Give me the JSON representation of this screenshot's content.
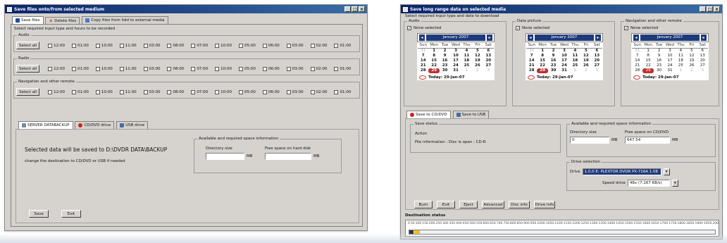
{
  "left": {
    "title": "Save files onto/from selected medium",
    "tabs": [
      {
        "label": "Save files",
        "icon": "save-disk-icon"
      },
      {
        "label": "Delete files",
        "icon": "red-x-icon"
      },
      {
        "label": "Copy files from hdd to external media",
        "icon": "copy-icon"
      }
    ],
    "instruction": "Select required input type and hours to be recorded",
    "groups": [
      {
        "label": "Audio",
        "select_all": "Select all",
        "times": [
          "12:00",
          "01:00",
          "10:00",
          "11:00",
          "03:00",
          "08:00",
          "07:00",
          "10:00",
          "05:00",
          "06:00",
          "03:00",
          "02:00",
          "01:00"
        ]
      },
      {
        "label": "Radio",
        "select_all": "Select all",
        "times": [
          "12:00",
          "01:00",
          "10:00",
          "11:00",
          "03:00",
          "08:00",
          "07:00",
          "10:00",
          "05:00",
          "06:00",
          "03:00",
          "02:00",
          "01:00"
        ]
      },
      {
        "label": "Navigation and other remote",
        "select_all": "Select all",
        "times": [
          "12:00",
          "01:00",
          "10:00",
          "11:00",
          "03:00",
          "08:00",
          "07:00",
          "10:00",
          "05:00",
          "06:00",
          "03:00",
          "02:00",
          "01:00"
        ]
      }
    ],
    "dest_tabs": [
      "SERVER DATABACKUP",
      "CD/DVD drive",
      "USB drive"
    ],
    "dest_text": "Selected data will be saved to D:\\DVDR DATA\\BACKUP",
    "dest_sub": "change the destination to CD/DVD or USB if needed",
    "space": {
      "legend": "Available and required space information",
      "dir_size_label": "Directory size",
      "free_space_label": "Free space on hard disk",
      "unit": "MB"
    },
    "buttons": {
      "save": "Save",
      "exit": "Exit"
    }
  },
  "right": {
    "title": "Save long range data on selected media",
    "instruction": "Select required input type and date to download",
    "calendars": [
      {
        "group": "Audio",
        "check_label": "None selected",
        "month": "January 2007",
        "days_head": [
          "Sun",
          "Mon",
          "Tue",
          "Wed",
          "Thu",
          "Fri",
          "Sat"
        ],
        "weeks": [
          [
            "31",
            "1",
            "2",
            "3",
            "4",
            "5",
            "6"
          ],
          [
            "7",
            "8",
            "9",
            "10",
            "11",
            "12",
            "13"
          ],
          [
            "14",
            "15",
            "16",
            "17",
            "18",
            "19",
            "20"
          ],
          [
            "21",
            "22",
            "23",
            "24",
            "25",
            "26",
            "27"
          ],
          [
            "28",
            "29",
            "30",
            "31",
            "1",
            "2",
            "3"
          ]
        ],
        "today": "Today: 29-Jan-07"
      },
      {
        "group": "Data picture",
        "check_label": "None selected",
        "month": "January 2007",
        "days_head": [
          "Sun",
          "Mon",
          "Tue",
          "Wed",
          "Thu",
          "Fri",
          "Sat"
        ],
        "weeks": [
          [
            "31",
            "1",
            "2",
            "3",
            "4",
            "5",
            "6"
          ],
          [
            "7",
            "8",
            "9",
            "10",
            "11",
            "12",
            "13"
          ],
          [
            "14",
            "15",
            "16",
            "17",
            "18",
            "19",
            "20"
          ],
          [
            "21",
            "22",
            "23",
            "24",
            "25",
            "26",
            "27"
          ],
          [
            "28",
            "29",
            "30",
            "31",
            "1",
            "2",
            "3"
          ]
        ],
        "today": "Today: 29-Jan-07"
      },
      {
        "group": "Navigation and other remote",
        "check_label": "None selected",
        "month": "January 2007",
        "days_head": [
          "Sun",
          "Mon",
          "Tue",
          "Wed",
          "Thu",
          "Fri",
          "Sat"
        ],
        "weeks": [
          [
            "31",
            "1",
            "2",
            "3",
            "4",
            "5",
            "6"
          ],
          [
            "7",
            "8",
            "9",
            "10",
            "11",
            "12",
            "13"
          ],
          [
            "14",
            "15",
            "16",
            "17",
            "18",
            "19",
            "20"
          ],
          [
            "21",
            "22",
            "23",
            "24",
            "25",
            "26",
            "27"
          ],
          [
            "28",
            "29",
            "30",
            "31",
            "1",
            "2",
            "3"
          ]
        ],
        "today": "Today: 29-Jan-07"
      }
    ],
    "dest_tabs": [
      "Save to CD/DVD",
      "Save to USB"
    ],
    "status": {
      "legend": "Save status",
      "action": "Action",
      "info": "File information : Disc is open : CD-R"
    },
    "space": {
      "legend": "Available and required space information",
      "dir_size_label": "Directory size",
      "free_space_label": "Free space on CD/DVD",
      "dir_size_value": "0",
      "free_space_value": "647.54",
      "unit": "MB"
    },
    "drive": {
      "legend": "Drive selection",
      "drive_label": "Drive",
      "drive_value": "1,0,0 E: PLEXTOR DVDR PX-716A 1.08",
      "speed_label": "Speed drive",
      "speed_value": "48x (7,167 KB/s)"
    },
    "buttons": [
      "Burn",
      "Exit",
      "Eject",
      "Advanced",
      "Disc info",
      "Drive info"
    ],
    "ruler_title": "Destination status",
    "ruler_ticks": [
      "0",
      "50",
      "100",
      "150",
      "200",
      "250",
      "300",
      "350",
      "400",
      "450",
      "500",
      "550",
      "600",
      "650",
      "700",
      "750",
      "800",
      "850",
      "900",
      "950",
      "1000",
      "1050",
      "1100",
      "1150",
      "1200",
      "1250",
      "1300",
      "1350",
      "1400",
      "1450",
      "1500",
      "1550",
      "1600",
      "1650",
      "1700",
      "1750",
      "1800",
      "1850",
      "1900",
      "1950",
      "2000",
      "2050",
      "2100",
      "2150",
      "2200",
      "2250",
      "2300",
      "2350",
      "2400",
      "2450",
      "2500"
    ]
  },
  "colors": {
    "titlebar": "#0a246a",
    "window": "#d6d3ce",
    "accent_red": "#c03030",
    "cal_header": "#1f3a7a"
  }
}
